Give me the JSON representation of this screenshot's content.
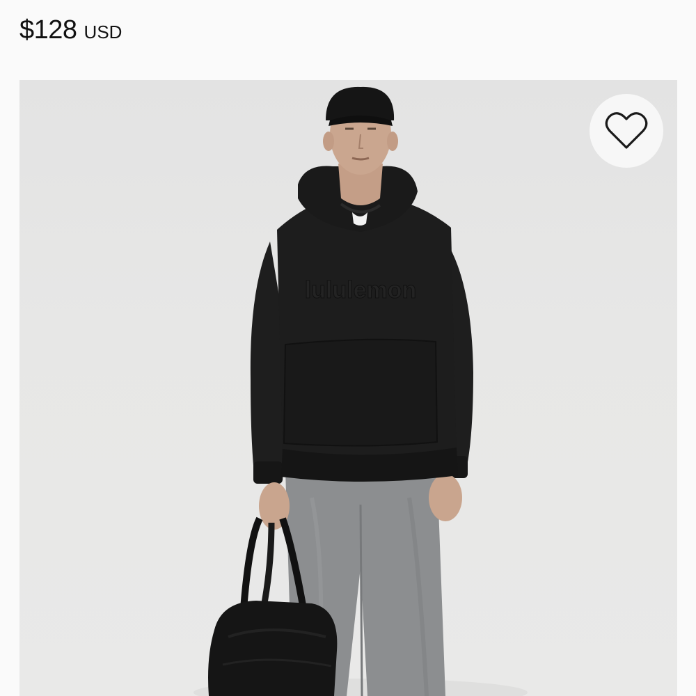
{
  "product": {
    "price": "$128",
    "currency": "USD",
    "image_alt": "Man wearing black hoodie, grey pants and black cap, holding a black duffel bag",
    "hoodie_logo_text": "lululemon"
  },
  "icons": {
    "wishlist": "heart-icon"
  },
  "colors": {
    "background": "#fafafa",
    "image_background": "#e6e6e5",
    "hoodie": "#1c1c1c",
    "pants": "#8a8c8e",
    "text": "#111111"
  }
}
